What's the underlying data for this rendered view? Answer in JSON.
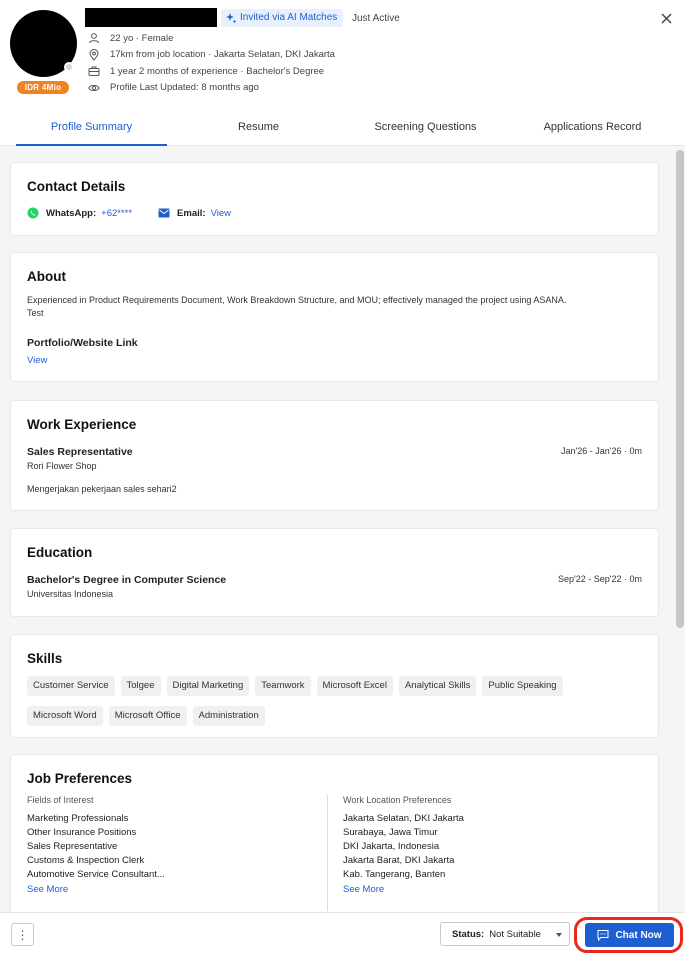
{
  "header": {
    "salary_badge": "IDR 4Mio",
    "invited_label": "Invited via AI Matches",
    "activity": "Just Active",
    "info": [
      {
        "icon": "person-icon",
        "text": "22 yo · Female"
      },
      {
        "icon": "location-pin-icon",
        "text": "17km from job location · Jakarta Selatan, DKI Jakarta"
      },
      {
        "icon": "briefcase-icon",
        "text": "1 year 2 months of experience · Bachelor's Degree"
      },
      {
        "icon": "eye-icon",
        "text": "Profile Last Updated: 8 months ago"
      }
    ]
  },
  "tabs": [
    {
      "label": "Profile Summary",
      "active": true
    },
    {
      "label": "Resume",
      "active": false
    },
    {
      "label": "Screening Questions",
      "active": false
    },
    {
      "label": "Applications Record",
      "active": false
    }
  ],
  "contact": {
    "title": "Contact Details",
    "whatsapp_label": "WhatsApp:",
    "whatsapp_value": "+62****",
    "email_label": "Email:",
    "email_value": "View"
  },
  "about": {
    "title": "About",
    "text_line1": "Experienced in Product Requirements Document, Work Breakdown Structure, and MOU; effectively managed the project using ASANA.",
    "text_line2": "Test",
    "portfolio_title": "Portfolio/Website Link",
    "portfolio_link": "View"
  },
  "work": {
    "title": "Work Experience",
    "role": "Sales Representative",
    "company": "Rori Flower Shop",
    "period": "Jan'26 - Jan'26 · 0m",
    "description": "Mengerjakan pekerjaan sales sehari2"
  },
  "education": {
    "title": "Education",
    "degree": "Bachelor's Degree in Computer Science",
    "school": "Universitas Indonesia",
    "period": "Sep'22 - Sep'22 · 0m"
  },
  "skills": {
    "title": "Skills",
    "items": [
      "Customer Service",
      "Tolgee",
      "Digital Marketing",
      "Teamwork",
      "Microsoft Excel",
      "Analytical Skills",
      "Public Speaking",
      "Microsoft Word",
      "Microsoft Office",
      "Administration"
    ]
  },
  "preferences": {
    "title": "Job Preferences",
    "fields_heading": "Fields of Interest",
    "fields": [
      "Marketing Professionals",
      "Other Insurance Positions",
      "Sales Representative",
      "Customs & Inspection Clerk",
      "Automotive Service Consultant..."
    ],
    "fields_more": "See More",
    "locations_heading": "Work Location Preferences",
    "locations": [
      "Jakarta Selatan, DKI Jakarta",
      "Surabaya, Jawa Timur",
      "DKI Jakarta, Indonesia",
      "Jakarta Barat, DKI Jakarta",
      "Kab. Tangerang, Banten"
    ],
    "locations_more": "See More"
  },
  "footer": {
    "more_label": "⋮",
    "status_label": "Status:",
    "status_value": "Not Suitable",
    "chat_label": "Chat Now"
  },
  "colors": {
    "accent": "#1d5fd1",
    "salary_badge": "#ef8222",
    "highlight_ring": "#e8281c",
    "whatsapp": "#25d366"
  }
}
